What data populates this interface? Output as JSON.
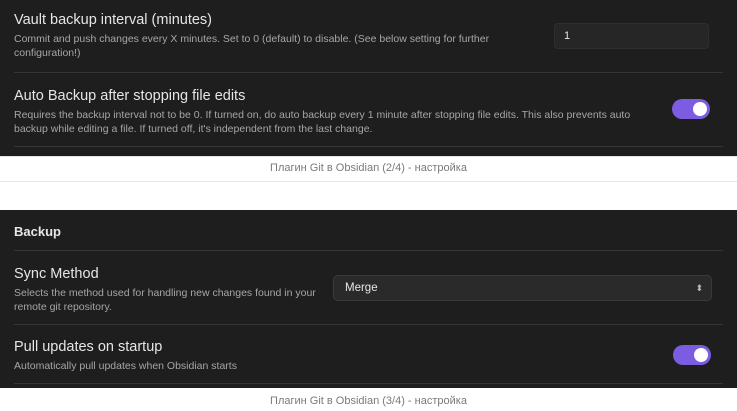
{
  "panel1": {
    "vault_interval": {
      "title": "Vault backup interval (minutes)",
      "description": "Commit and push changes every X minutes. Set to 0 (default) to disable. (See below setting for further configuration!)",
      "value": "1"
    },
    "auto_backup": {
      "title": "Auto Backup after stopping file edits",
      "description": "Requires the backup interval not to be 0. If turned on, do auto backup every 1 minute after stopping file edits. This also prevents auto backup while editing a file. If turned off, it's independent from the last change.",
      "enabled": true
    }
  },
  "caption1": "Плагин Git в Obsidian (2/4) - настройка",
  "panel2": {
    "heading": "Backup",
    "sync_method": {
      "title": "Sync Method",
      "description": "Selects the method used for handling new changes found in your remote git repository.",
      "selected": "Merge"
    },
    "pull_on_startup": {
      "title": "Pull updates on startup",
      "description": "Automatically pull updates when Obsidian starts",
      "enabled": true
    }
  },
  "caption2": "Плагин Git в Obsidian (3/4) - настройка",
  "colors": {
    "accent": "#7c5ce0",
    "panel_bg": "#1e1e1e"
  },
  "icons": {
    "select_arrow": "chevron-updown-icon"
  }
}
